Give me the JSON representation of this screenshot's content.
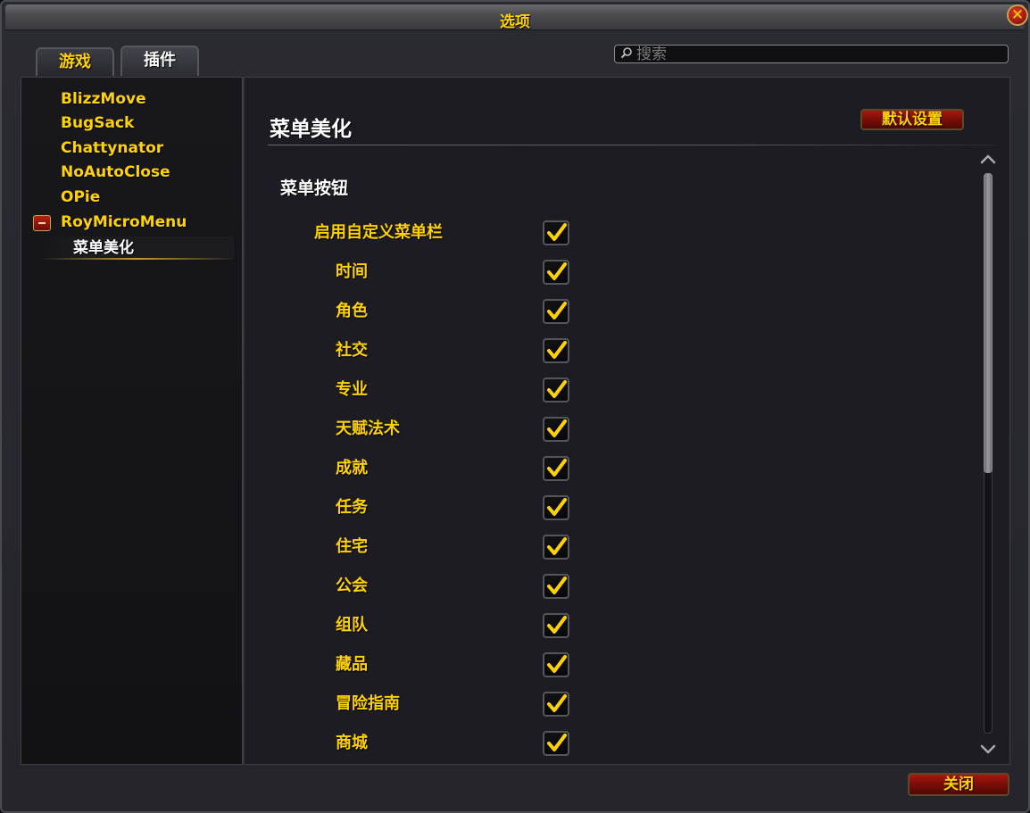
{
  "window": {
    "title": "选项",
    "close_glyph": "✕"
  },
  "tabs": [
    {
      "label": "游戏",
      "active": false
    },
    {
      "label": "插件",
      "active": true
    }
  ],
  "search": {
    "placeholder": "搜索",
    "value": ""
  },
  "sidebar": {
    "items": [
      {
        "label": "BlizzMove"
      },
      {
        "label": "BugSack"
      },
      {
        "label": "Chattynator"
      },
      {
        "label": "NoAutoClose"
      },
      {
        "label": "OPie"
      },
      {
        "label": "RoyMicroMenu",
        "expanded": true
      }
    ],
    "selected_child": {
      "label": "菜单美化"
    }
  },
  "panel": {
    "title": "菜单美化",
    "defaults_button": "默认设置",
    "section_title": "菜单按钮",
    "options": [
      {
        "label": "启用自定义菜单栏",
        "checked": true
      },
      {
        "label": "时间",
        "checked": true
      },
      {
        "label": "角色",
        "checked": true
      },
      {
        "label": "社交",
        "checked": true
      },
      {
        "label": "专业",
        "checked": true
      },
      {
        "label": "天赋法术",
        "checked": true
      },
      {
        "label": "成就",
        "checked": true
      },
      {
        "label": "任务",
        "checked": true
      },
      {
        "label": "住宅",
        "checked": true
      },
      {
        "label": "公会",
        "checked": true
      },
      {
        "label": "组队",
        "checked": true
      },
      {
        "label": "藏品",
        "checked": true
      },
      {
        "label": "冒险指南",
        "checked": true
      },
      {
        "label": "商城",
        "checked": true
      }
    ]
  },
  "footer": {
    "close_button": "关闭"
  },
  "icons": {
    "search": "search-icon",
    "check": "check-icon",
    "collapse": "minus-icon",
    "scroll_up": "chevron-up-icon",
    "scroll_down": "chevron-down-icon"
  },
  "colors": {
    "label_gold": "#ffd200",
    "button_red": "#8a1209",
    "panel_bg": "#1c1c22"
  }
}
